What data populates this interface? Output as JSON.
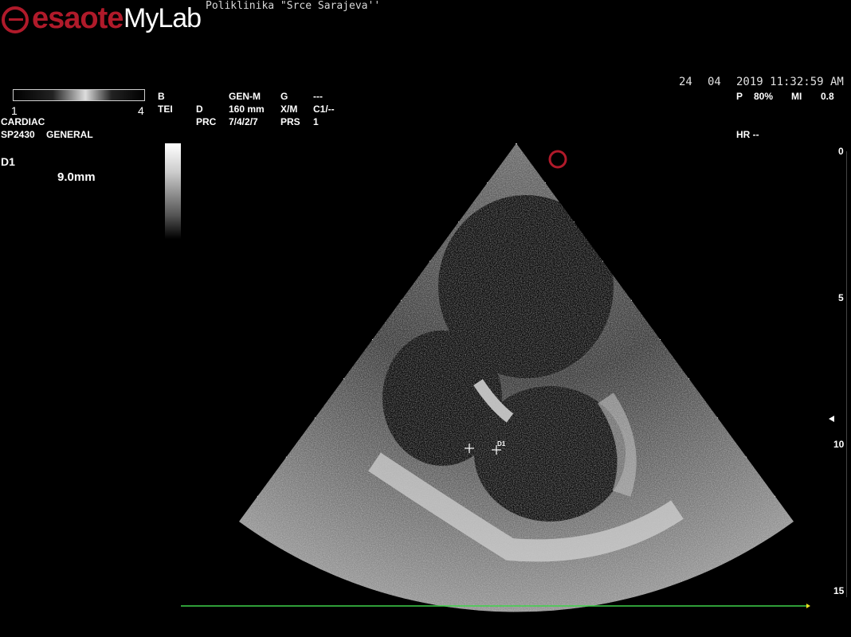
{
  "header": {
    "brand": "esaote",
    "product": "MyLab",
    "clinic": "Poliklinika \"Srce Sarajeva''"
  },
  "datetime": {
    "day": "24",
    "month": "04",
    "year_time": "2019 11:32:59 AM"
  },
  "power": {
    "p_label": "P",
    "p_value": "80%",
    "mi_label": "MI",
    "mi_value": "0.8"
  },
  "hr": "HR --",
  "grayscale": {
    "min": "1",
    "max": "4"
  },
  "params": {
    "row1": [
      "B",
      "GEN-M",
      "G",
      "---"
    ],
    "row2": [
      "TEI",
      "D",
      "160 mm",
      "X/M",
      "C1/--"
    ],
    "row3": [
      "PRC",
      "7/4/2/7",
      "PRS",
      "1"
    ]
  },
  "preset": {
    "exam": "CARDIAC",
    "probe": "SP2430",
    "application": "GENERAL"
  },
  "measurement": {
    "label": "D1",
    "value": "9.0mm",
    "marker_label": "D1"
  },
  "depth_scale": [
    "0",
    "5",
    "10",
    "15"
  ],
  "colors": {
    "brand_red": "#b01a2a",
    "ecg_trace": "#3fd34a",
    "ecg_marker": "#e8e020"
  }
}
